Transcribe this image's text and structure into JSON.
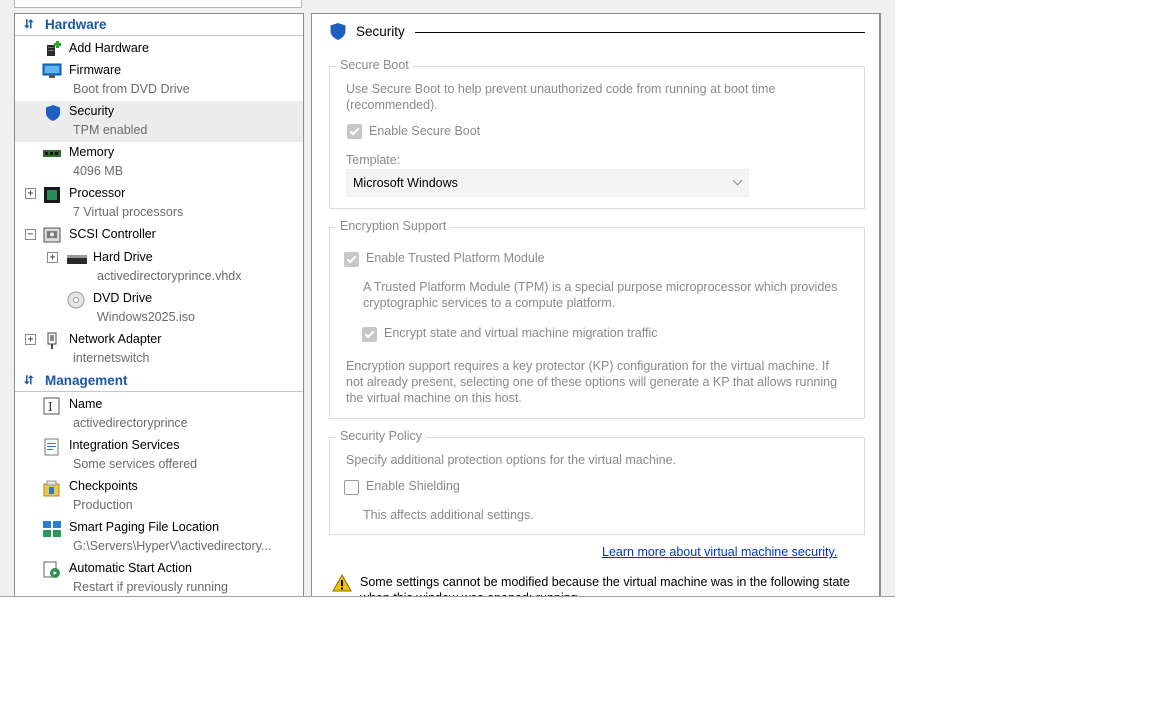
{
  "sidebar": {
    "hardware_label": "Hardware",
    "management_label": "Management",
    "hardware_items": [
      {
        "label": "Add Hardware",
        "sub": "",
        "icon": "add-hardware-icon"
      },
      {
        "label": "Firmware",
        "sub": "Boot from DVD Drive",
        "icon": "firmware-icon"
      },
      {
        "label": "Security",
        "sub": "TPM enabled",
        "icon": "shield-icon",
        "selected": true
      },
      {
        "label": "Memory",
        "sub": "4096 MB",
        "icon": "memory-icon"
      },
      {
        "label": "Processor",
        "sub": "7 Virtual processors",
        "icon": "processor-icon",
        "expander": "+"
      },
      {
        "label": "SCSI Controller",
        "sub": "",
        "icon": "scsi-controller-icon",
        "expander": "−"
      },
      {
        "label": "Hard Drive",
        "sub": "activedirectoryprince.vhdx",
        "icon": "hard-drive-icon",
        "expander": "+"
      },
      {
        "label": "DVD Drive",
        "sub": "Windows2025.iso",
        "icon": "dvd-drive-icon"
      },
      {
        "label": "Network Adapter",
        "sub": "internetswitch",
        "icon": "network-adapter-icon",
        "expander": "+"
      }
    ],
    "management_items": [
      {
        "label": "Name",
        "sub": "activedirectoryprince",
        "icon": "name-icon"
      },
      {
        "label": "Integration Services",
        "sub": "Some services offered",
        "icon": "integration-services-icon"
      },
      {
        "label": "Checkpoints",
        "sub": "Production",
        "icon": "checkpoints-icon"
      },
      {
        "label": "Smart Paging File Location",
        "sub": "G:\\Servers\\HyperV\\activedirectory...",
        "icon": "smart-paging-icon"
      },
      {
        "label": "Automatic Start Action",
        "sub": "Restart if previously running",
        "icon": "automatic-start-icon"
      }
    ]
  },
  "panel": {
    "title": "Security",
    "secure_boot": {
      "group_title": "Secure Boot",
      "description": "Use Secure Boot to help prevent unauthorized code from running at boot time (recommended).",
      "enable_label": "Enable Secure Boot",
      "enable_checked": true,
      "template_label": "Template:",
      "template_value": "Microsoft Windows"
    },
    "encryption": {
      "group_title": "Encryption Support",
      "tpm_label": "Enable Trusted Platform Module",
      "tpm_checked": true,
      "tpm_description": "A Trusted Platform Module (TPM) is a special purpose microprocessor which provides cryptographic services to a compute platform.",
      "encrypt_label": "Encrypt state and virtual machine migration traffic",
      "encrypt_checked": true,
      "kp_note": "Encryption support requires a key protector (KP) configuration for the virtual machine. If not already present, selecting one of these options will generate a KP that allows running the virtual machine on this host."
    },
    "policy": {
      "group_title": "Security Policy",
      "description": "Specify additional protection options for the virtual machine.",
      "shielding_label": "Enable Shielding",
      "shielding_checked": false,
      "shielding_note": "This affects additional settings."
    },
    "learn_more": "Learn more about virtual machine security.",
    "warning": "Some settings cannot be modified because the virtual machine was in the following state when this window was opened: running."
  },
  "colors": {
    "section_header": "#1a56a8",
    "shield": "#1f5fbf",
    "link": "#0033cc",
    "disabled_text": "#8a8a8a",
    "selection": "#ececec",
    "warning": "#f2c200"
  }
}
